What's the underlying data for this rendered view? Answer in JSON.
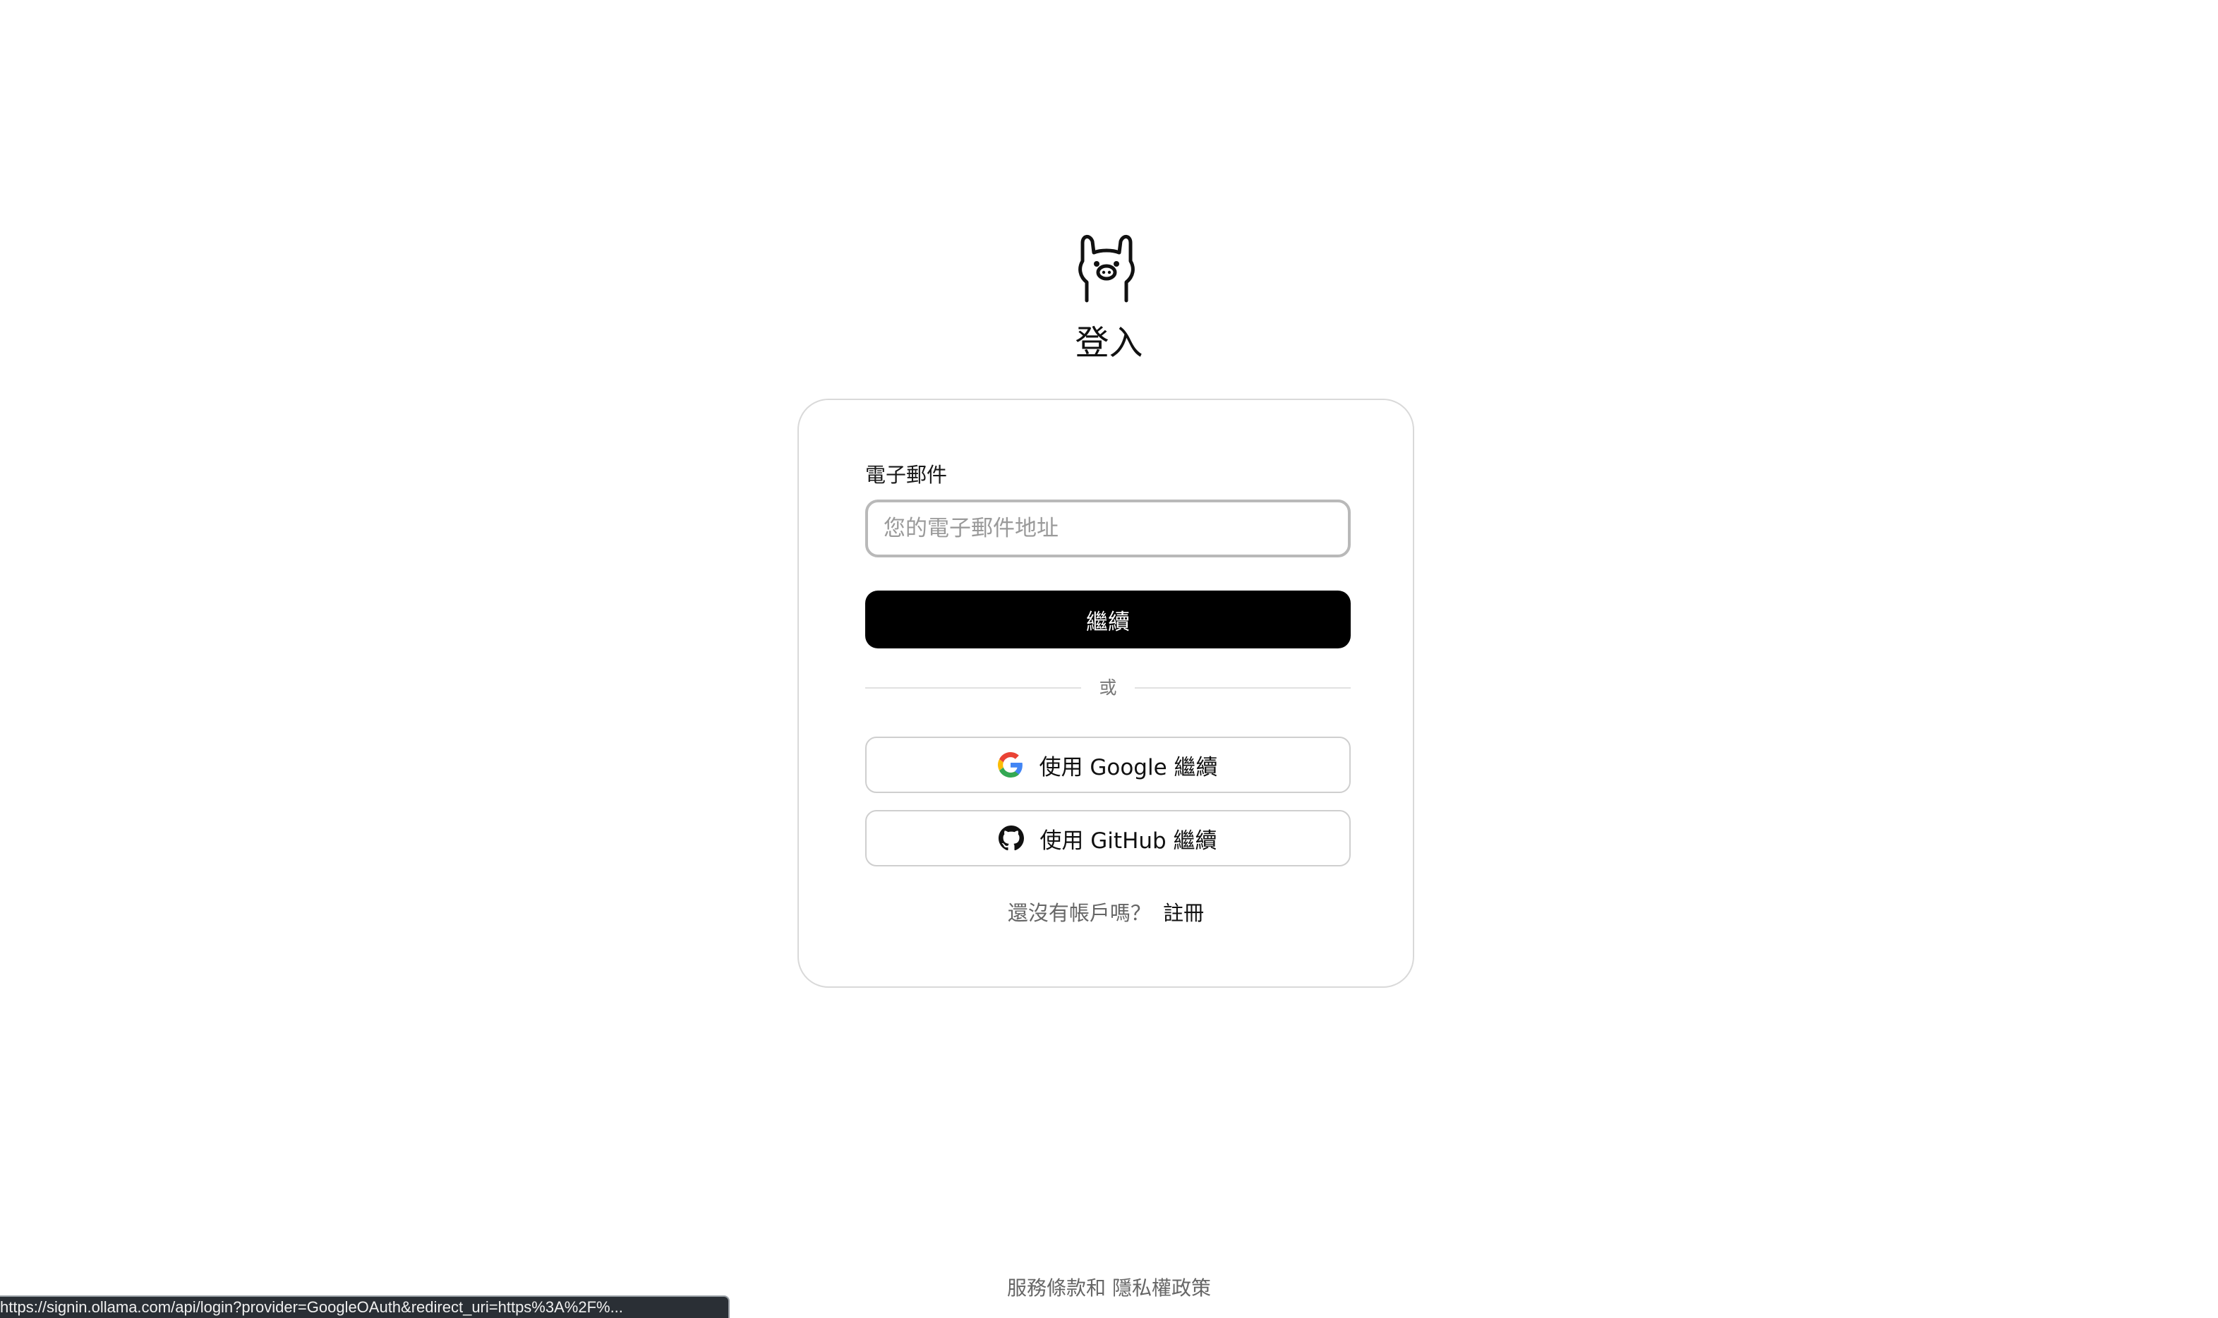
{
  "page": {
    "title": "登入"
  },
  "form": {
    "email_label": "電子郵件",
    "email_placeholder": "您的電子郵件地址",
    "email_value": "",
    "continue_label": "繼續",
    "divider_text": "或",
    "google_label": "使用 Google 繼續",
    "github_label": "使用 GitHub 繼續",
    "signup_prompt": "還沒有帳戶嗎？",
    "signup_link": "註冊"
  },
  "footer": {
    "terms": "服務條款",
    "conjunction": "和",
    "privacy": "隱私權政策"
  },
  "status_bar": {
    "url": "https://signin.ollama.com/api/login?provider=GoogleOAuth&redirect_uri=https%3A%2F%..."
  },
  "icons": {
    "logo": "ollama-llama-logo",
    "google": "google-g-icon",
    "github": "github-octocat-icon"
  },
  "colors": {
    "primary_button": "#000000",
    "primary_button_text": "#ffffff",
    "border": "#d9d9d9"
  }
}
